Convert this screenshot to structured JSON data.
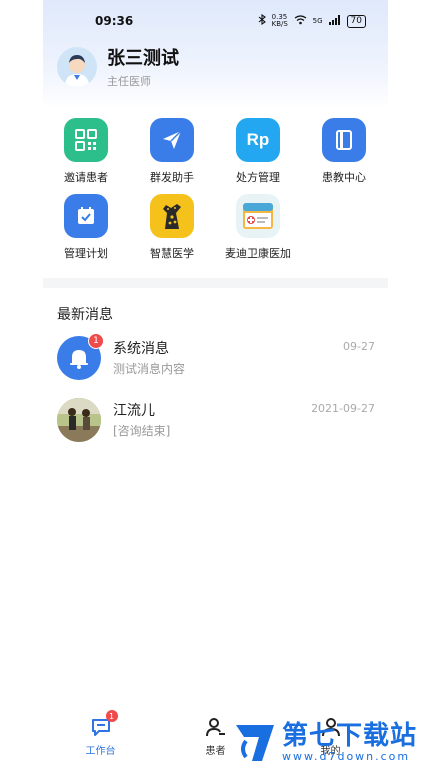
{
  "status_bar": {
    "time": "09:36",
    "network_speed": "0.35 KB/S",
    "signal": "5G",
    "battery": "70"
  },
  "profile": {
    "name": "张三测试",
    "title": "主任医师"
  },
  "grid": {
    "items": [
      {
        "label": "邀请患者",
        "icon": "qr-code-icon",
        "color": "#2dbf8b"
      },
      {
        "label": "群发助手",
        "icon": "send-icon",
        "color": "#3b7de8"
      },
      {
        "label": "处方管理",
        "icon_text": "Rp",
        "icon": "prescription-icon",
        "color": "#22a7f0"
      },
      {
        "label": "患教中心",
        "icon": "book-icon",
        "color": "#3b7de8"
      },
      {
        "label": "管理计划",
        "icon": "calendar-icon",
        "color": "#3b7de8"
      },
      {
        "label": "智慧医学",
        "icon": "giraffe-icon",
        "color": "#f5c21b"
      },
      {
        "label": "麦迪卫康医加",
        "icon": "medical-kit-icon",
        "color": "#e8f3f5"
      }
    ]
  },
  "messages_section": {
    "title": "最新消息",
    "items": [
      {
        "title": "系统消息",
        "preview": "测试消息内容",
        "time": "09-27",
        "badge": "1",
        "avatar": "bell-icon"
      },
      {
        "title": "江流儿",
        "preview": "[咨询结束]",
        "time": "2021-09-27",
        "avatar": "photo-avatar"
      }
    ]
  },
  "tabbar": {
    "tabs": [
      {
        "label": "工作台",
        "badge": "1",
        "active": true
      },
      {
        "label": "患者"
      },
      {
        "label": "我的"
      }
    ]
  },
  "watermark": {
    "name": "第七下载站",
    "url": "www.d7down.com"
  },
  "colors": {
    "accent": "#2f73e6",
    "badge": "#f04a4a"
  }
}
